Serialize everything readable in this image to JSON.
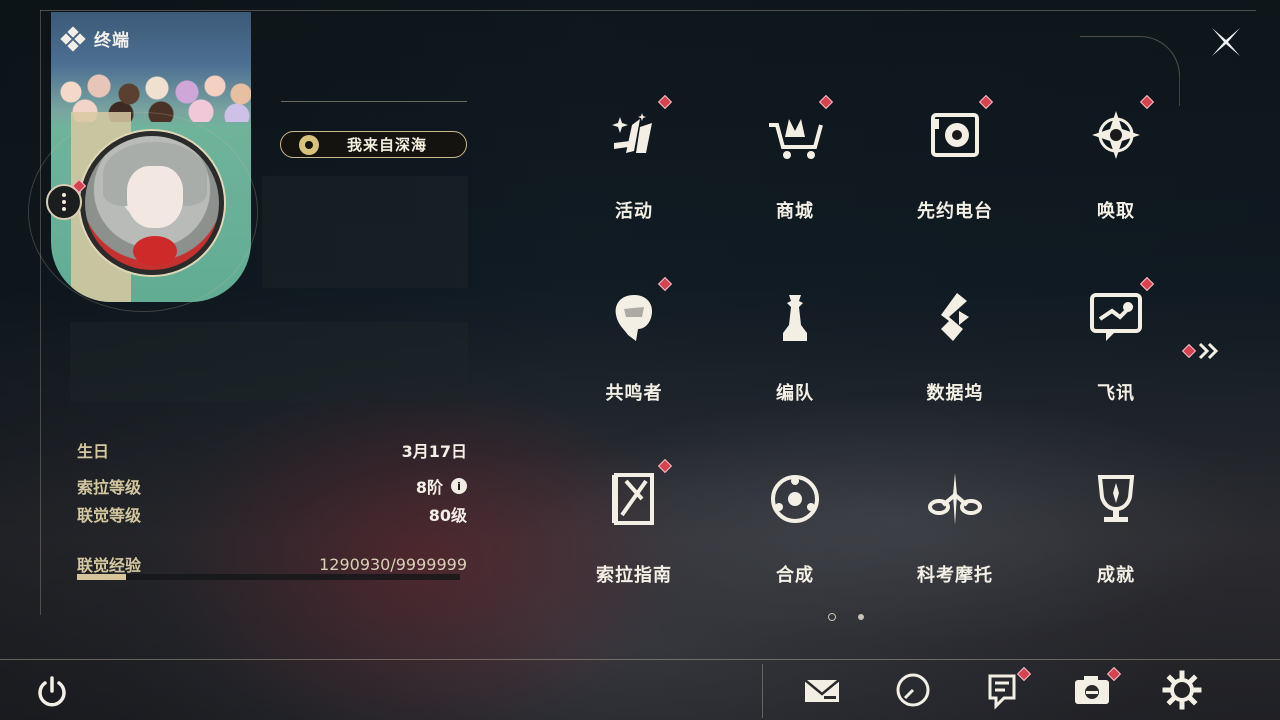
{
  "header": {
    "title": "终端",
    "close_icon": "close-x-icon"
  },
  "profile": {
    "title_badge": "我来自深海",
    "stats": {
      "birthday_label": "生日",
      "birthday_value": "3月17日",
      "sola_level_label": "索拉等级",
      "sola_level_value": "8阶",
      "union_level_label": "联觉等级",
      "union_level_value": "80级",
      "union_exp_label": "联觉经验",
      "union_exp_value": "1290930/9999999",
      "union_exp_fraction": 0.129
    }
  },
  "menu": {
    "items": [
      {
        "label": "活动",
        "icon": "activity-icon",
        "badge": true
      },
      {
        "label": "商城",
        "icon": "shop-cart-icon",
        "badge": true
      },
      {
        "label": "先约电台",
        "icon": "radio-icon",
        "badge": true
      },
      {
        "label": "唤取",
        "icon": "convene-icon",
        "badge": true
      },
      {
        "label": "共鸣者",
        "icon": "resonator-icon",
        "badge": true
      },
      {
        "label": "编队",
        "icon": "team-icon",
        "badge": false
      },
      {
        "label": "数据坞",
        "icon": "data-bank-icon",
        "badge": false
      },
      {
        "label": "飞讯",
        "icon": "chat-icon",
        "badge": true
      },
      {
        "label": "索拉指南",
        "icon": "guidebook-icon",
        "badge": true
      },
      {
        "label": "合成",
        "icon": "synthesis-icon",
        "badge": false
      },
      {
        "label": "科考摩托",
        "icon": "motorbike-icon",
        "badge": false
      },
      {
        "label": "成就",
        "icon": "trophy-icon",
        "badge": false
      }
    ],
    "pagination": {
      "current": 1,
      "total": 2
    }
  },
  "bottom_bar": {
    "icons": [
      "power-icon",
      "mail-icon",
      "clock-icon",
      "notice-icon",
      "camera-icon",
      "settings-gear-icon"
    ]
  },
  "colors": {
    "accent": "#d8c49a",
    "badge": "#d54250",
    "text": "#f3efe4"
  }
}
